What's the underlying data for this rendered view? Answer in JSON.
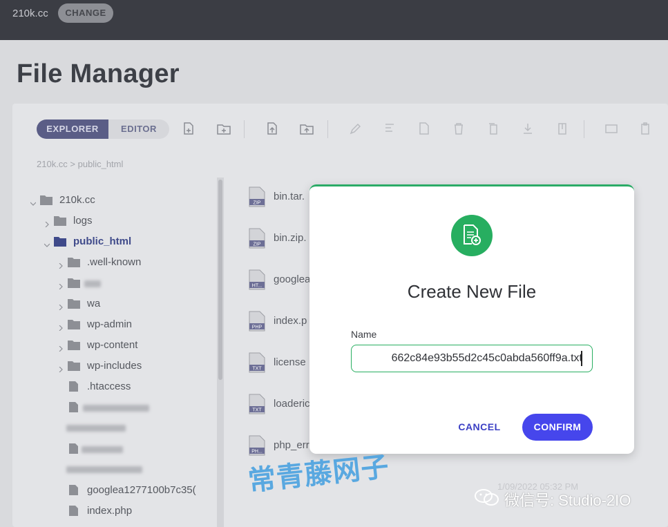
{
  "topbar": {
    "domain": "210k.cc",
    "change_label": "CHANGE"
  },
  "page": {
    "title": "File Manager"
  },
  "tabs": {
    "explorer": "EXPLORER",
    "editor": "EDITOR"
  },
  "breadcrumb": "210k.cc > public_html",
  "tree": {
    "root": "210k.cc",
    "logs": "logs",
    "public_html": "public_html",
    "well_known": ".well-known",
    "wa": "wa",
    "wp_admin": "wp-admin",
    "wp_content": "wp-content",
    "wp_includes": "wp-includes",
    "htaccess": ".htaccess",
    "googlea": "googlea1277100b7c35(",
    "index": "index.php"
  },
  "files": [
    {
      "name": "bin.tar.",
      "type": "ZIP"
    },
    {
      "name": "bin.zip.",
      "type": "ZIP"
    },
    {
      "name": "googlea",
      "type": "HT..."
    },
    {
      "name": "index.p",
      "type": "PHP"
    },
    {
      "name": "license",
      "type": "TXT"
    },
    {
      "name": "loaderic",
      "type": "TXT"
    },
    {
      "name": "php_err",
      "type": "PH..."
    }
  ],
  "ghost_date": "1/09/2022 05:32 PM",
  "modal": {
    "title": "Create New File",
    "name_label": "Name",
    "name_value": "662c84e93b55d2c45c0abda560ff9a.txt",
    "cancel_label": "CANCEL",
    "confirm_label": "CONFIRM"
  },
  "watermark": {
    "chinese": "常青藤网子",
    "wechat": "微信号: Studio-2IO"
  },
  "colors": {
    "accent_green": "#27ae60",
    "confirm_blue": "#4646ec",
    "topbar": "#3b3d44"
  }
}
